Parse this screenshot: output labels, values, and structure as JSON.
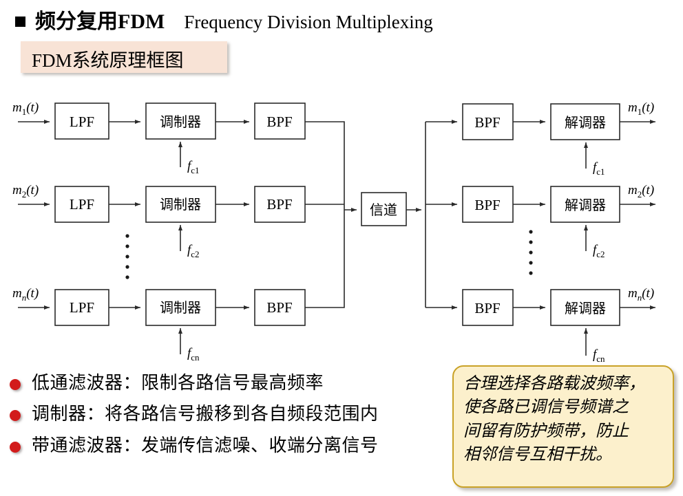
{
  "title": {
    "bullet_icon": "black-square-bullet",
    "chinese": "频分复用FDM",
    "english": "Frequency Division Multiplexing"
  },
  "banner": {
    "label": "FDM系统原理框图",
    "bg_color": "#f8e3d6"
  },
  "diagram": {
    "name": "fdm-system-block-diagram",
    "channel_block": "信道",
    "transmitter": {
      "lpf_label": "LPF",
      "modulator_label": "调制器",
      "bpf_label": "BPF",
      "rows": [
        {
          "input": "m",
          "input_sub": "1",
          "input_arg": "(t)",
          "carrier": "f",
          "carrier_sub": "c1"
        },
        {
          "input": "m",
          "input_sub": "2",
          "input_arg": "(t)",
          "carrier": "f",
          "carrier_sub": "c2"
        },
        {
          "input": "m",
          "input_sub": "n",
          "input_arg": "(t)",
          "carrier": "f",
          "carrier_sub": "cn"
        }
      ]
    },
    "receiver": {
      "bpf_label": "BPF",
      "demodulator_label": "解调器",
      "rows": [
        {
          "output": "m",
          "output_sub": "1",
          "output_arg": "(t)",
          "carrier": "f",
          "carrier_sub": "c1"
        },
        {
          "output": "m",
          "output_sub": "2",
          "output_arg": "(t)",
          "carrier": "f",
          "carrier_sub": "c2"
        },
        {
          "output": "m",
          "output_sub": "n",
          "output_arg": "(t)",
          "carrier": "f",
          "carrier_sub": "cn"
        }
      ]
    },
    "ellipsis": "vertical-dots"
  },
  "bullets": {
    "marker_color": "#d21b1b",
    "items": [
      "低通滤波器：限制各路信号最高频率",
      "调制器：将各路信号搬移到各自频段范围内",
      "带通滤波器：发端传信滤噪、收端分离信号"
    ]
  },
  "callout": {
    "bg_color": "#fcf0cc",
    "border_color": "#c9a227",
    "lines": [
      "合理选择各路载波频率，",
      "使各路已调信号频谱之",
      "间留有防护频带，防止",
      "相邻信号互相干扰。"
    ]
  }
}
